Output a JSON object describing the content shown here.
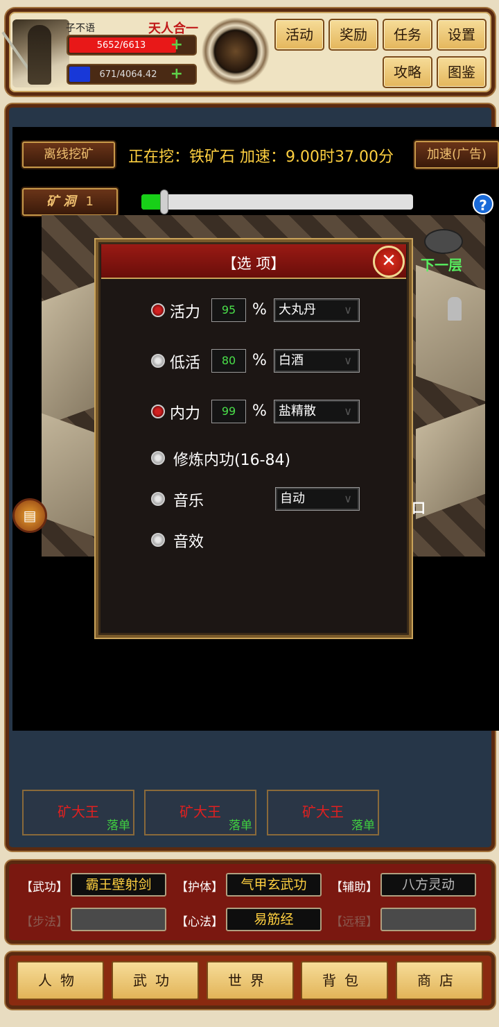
{
  "player": {
    "name": "子不语",
    "realm": "天人合一",
    "hp": "5652/6613",
    "hp_ratio": 0.855,
    "mp": "671/4064.42",
    "mp_ratio": 0.165,
    "plus": "+"
  },
  "top_buttons": [
    "活动",
    "奖励",
    "任务",
    "设置",
    "攻略",
    "图鉴"
  ],
  "mining": {
    "offline_label": "离线挖矿",
    "status": "正在挖：铁矿石 加速：9.00时37.00分",
    "speed_label": "加速(广告)",
    "cave_label": "矿 洞",
    "cave_num": "1",
    "progress": 0.08,
    "help": "?"
  },
  "map": {
    "next_floor": "下一层",
    "exit": "口"
  },
  "dialog": {
    "title": "【选 项】",
    "close": "✕",
    "options": [
      {
        "label": "活力",
        "checked": true,
        "value": "95",
        "unit": "%",
        "item": "大丸丹"
      },
      {
        "label": "低活",
        "checked": false,
        "value": "80",
        "unit": "%",
        "item": "白酒"
      },
      {
        "label": "内力",
        "checked": true,
        "value": "99",
        "unit": "%",
        "item": "盐精散"
      },
      {
        "label": "修炼内功(16-84)",
        "checked": false
      },
      {
        "label": "音乐",
        "checked": false,
        "item": "自动"
      },
      {
        "label": "音效",
        "checked": false
      }
    ]
  },
  "monsters": [
    {
      "name": "矿大王",
      "tag": "落单"
    },
    {
      "name": "矿大王",
      "tag": "落单"
    },
    {
      "name": "矿大王",
      "tag": "落单"
    }
  ],
  "skills": {
    "wugong": {
      "label": "【武功】",
      "value": "霸王壁射剑"
    },
    "huti": {
      "label": "【护体】",
      "value": "气甲玄武功"
    },
    "fuzhu": {
      "label": "【辅助】",
      "value": "八方灵动"
    },
    "bufa": {
      "label": "【步法】",
      "value": ""
    },
    "xinfa": {
      "label": "【心法】",
      "value": "易筋经"
    },
    "yuancheng": {
      "label": "【远程】",
      "value": ""
    }
  },
  "nav": [
    "人物",
    "武功",
    "世界",
    "背包",
    "商店"
  ],
  "colors": {
    "accent": "#ffd040",
    "hp": "#e81818",
    "mp": "#1838d8",
    "dialog_header": "#9a1a14"
  }
}
